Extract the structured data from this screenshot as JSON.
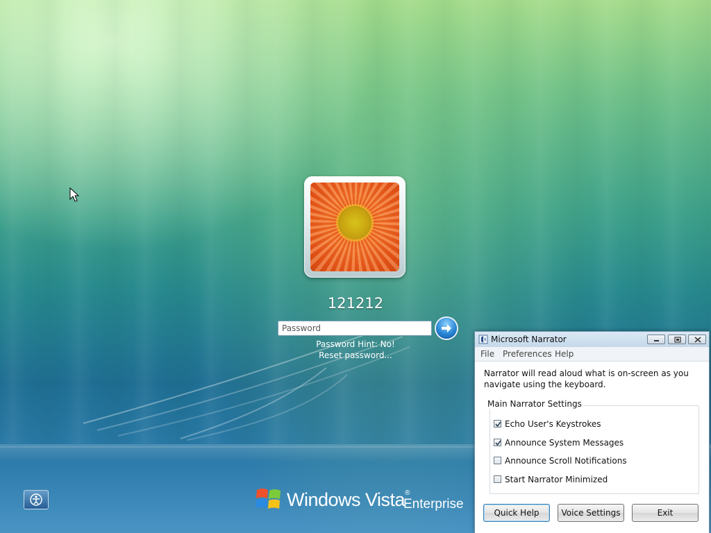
{
  "login": {
    "username": "121212",
    "password_placeholder": "Password",
    "password_hint": "Password Hint: No!",
    "reset_link": "Reset password..."
  },
  "branding": {
    "product": "Windows Vista",
    "trademark": "®",
    "edition": "Enterprise"
  },
  "narrator": {
    "title": "Microsoft Narrator",
    "menu": [
      "File",
      "Preferences",
      "Help"
    ],
    "description": "Narrator will read aloud what is on-screen as you navigate using the keyboard.",
    "group_title": "Main Narrator Settings",
    "options": [
      {
        "label": "Echo User's Keystrokes",
        "checked": true
      },
      {
        "label": "Announce System Messages",
        "checked": true
      },
      {
        "label": "Announce Scroll Notifications",
        "checked": false
      },
      {
        "label": "Start Narrator Minimized",
        "checked": false
      }
    ],
    "buttons": {
      "quick_help": "Quick Help",
      "voice_settings": "Voice Settings",
      "exit": "Exit"
    }
  },
  "icons": {
    "ease_of_access": "ease-of-access-icon",
    "submit": "arrow-right-icon",
    "logo": "windows-flag-icon"
  }
}
